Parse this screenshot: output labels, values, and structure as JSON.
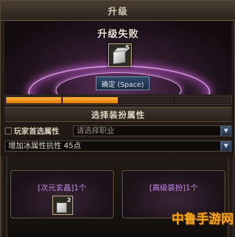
{
  "window": {
    "title": "升级"
  },
  "stage": {
    "result_text": "升级失败",
    "item_count": "5",
    "confirm_label": "确定 (Space)"
  },
  "progress": {
    "segments_total": 4,
    "segments_filled": 2,
    "fraction": 0.5
  },
  "section": {
    "title": "选择装扮属性"
  },
  "options": {
    "preferred_label": "玩家首选属性",
    "job_placeholder": "请选择职业",
    "attribute_value": "增加冰属性抗性 45点"
  },
  "slots": {
    "left_caption": "[次元玄晶]1个",
    "left_count": "2",
    "right_caption": "[高级装扮]1个"
  },
  "watermark": {
    "text": "中鲁手游网"
  },
  "colors": {
    "progress_fill": "#f0901a",
    "accent_purple": "#c48ae8",
    "button_blue": "#2f4a6a"
  }
}
